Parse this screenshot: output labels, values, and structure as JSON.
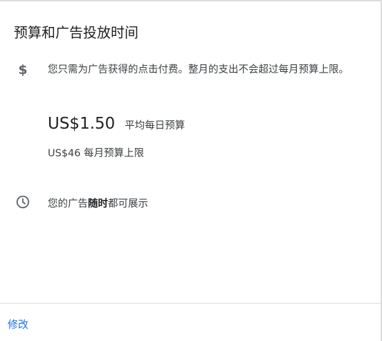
{
  "card": {
    "title": "预算和广告投放时间",
    "budget": {
      "icon": "dollar-icon",
      "description": "您只需为广告获得的点击付费。整月的支出不会超过每月预算上限。",
      "daily_amount": "US$1.50",
      "daily_label": "平均每日预算",
      "monthly_cap": "US$46 每月预算上限"
    },
    "schedule": {
      "icon": "clock-icon",
      "text_before": "您的广告",
      "text_bold": "随时",
      "text_after": "都可展示"
    },
    "footer": {
      "edit_label": "修改"
    }
  },
  "colors": {
    "link": "#1a73e8",
    "text": "#3c4043",
    "divider": "#dadce0"
  }
}
